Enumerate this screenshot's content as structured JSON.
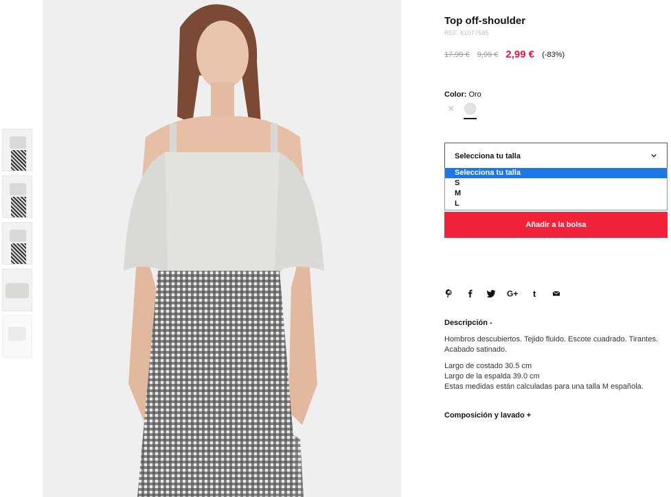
{
  "product": {
    "title": "Top off-shoulder",
    "ref": "REF. 81077585",
    "price_original": "17,99 €",
    "price_previous": "9,99 €",
    "price_current": "2,99 €",
    "discount": "(-83%)"
  },
  "color": {
    "label": "Color:",
    "value": "Oro",
    "swatches": [
      {
        "name": "Oro",
        "state": "unavailable",
        "hex": "#e6b7a6"
      },
      {
        "name": "Oro",
        "state": "selected",
        "hex": "#e3e3e3"
      }
    ]
  },
  "size_select": {
    "value": "Selecciona tu talla",
    "options": [
      "Selecciona tu talla",
      "S",
      "M",
      "L"
    ]
  },
  "add_to_bag": "Añadir a la bolsa",
  "share_icons": [
    "pinterest-icon",
    "facebook-icon",
    "twitter-icon",
    "google-plus-icon",
    "tumblr-icon",
    "email-icon"
  ],
  "description": {
    "heading": "Descripción -",
    "text1": "Hombros descubiertos. Tejido fluido. Escote cuadrado. Tirantes. Acabado satinado.",
    "line1": "Largo de costado 30.5 cm",
    "line2": "Largo de la espalda 39.0 cm",
    "line3": "Estas medidas están calculadas para una talla M española."
  },
  "composition_heading": "Composición y lavado +",
  "colors": {
    "accent_red": "#f0233a",
    "price_red": "#e5173f",
    "dropdown_blue": "#1e77e6"
  }
}
